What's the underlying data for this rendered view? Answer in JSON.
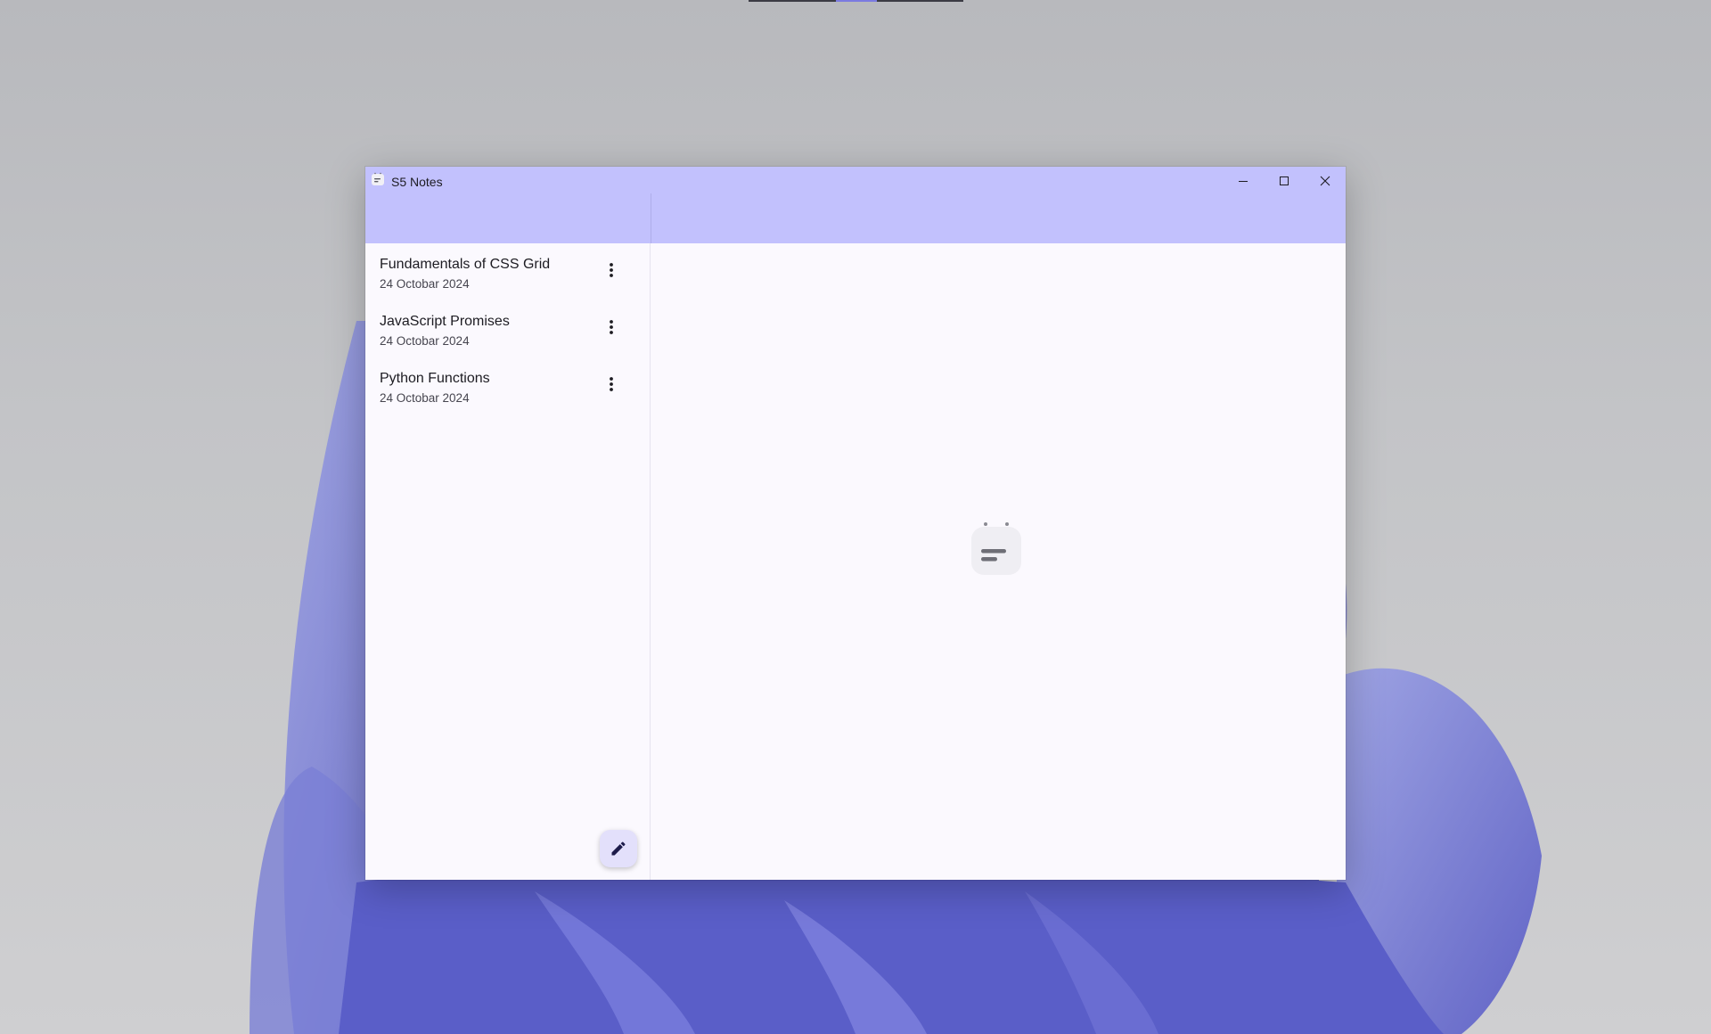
{
  "window": {
    "title": "S5 Notes",
    "controls": {
      "minimize": "minimize-icon",
      "maximize": "maximize-icon",
      "close": "close-icon"
    }
  },
  "sidebar": {
    "notes": [
      {
        "title": "Fundamentals of CSS Grid",
        "date": "24 Octobar 2024"
      },
      {
        "title": "JavaScript Promises",
        "date": "24 Octobar 2024"
      },
      {
        "title": "Python Functions",
        "date": "24 Octobar 2024"
      }
    ],
    "note_menu_icon": "more-vert-icon",
    "new_note_icon": "edit-pencil-icon"
  },
  "content": {
    "empty_state_icon": "notes-app-icon"
  },
  "colors": {
    "accent": "#c2c1fd",
    "surface": "#fbf9fe",
    "fab": "#e3e0fb",
    "text": "#1d1c22"
  }
}
